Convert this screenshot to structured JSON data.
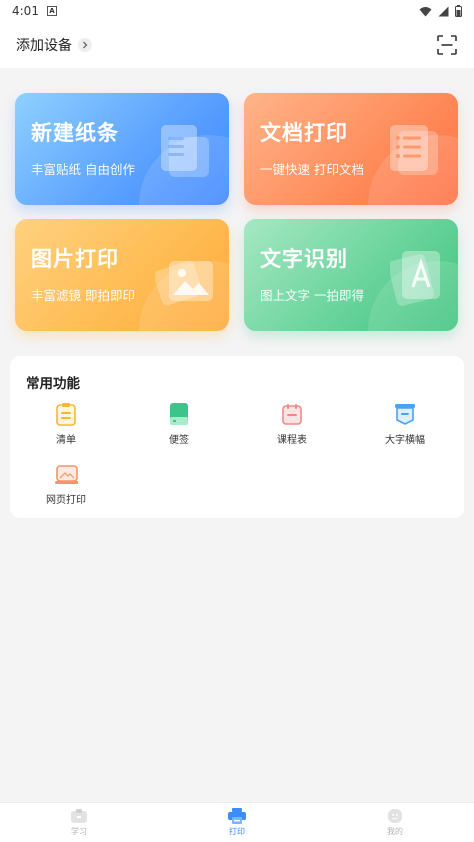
{
  "status_bar": {
    "time": "4:01",
    "notification_badge": "A",
    "icons": [
      "wifi-icon",
      "signal-icon",
      "battery-icon"
    ]
  },
  "header": {
    "add_device_label": "添加设备",
    "scan_icon": "scan-icon"
  },
  "cards": [
    {
      "title": "新建纸条",
      "subtitle": "丰富贴纸 自由创作",
      "icon": "document-icon",
      "color": "#4f96ff"
    },
    {
      "title": "文档打印",
      "subtitle": "一键快速 打印文档",
      "icon": "list-document-icon",
      "color": "#ff8552"
    },
    {
      "title": "图片打印",
      "subtitle": "丰富滤镜 即拍即印",
      "icon": "image-icon",
      "color": "#ffb547"
    },
    {
      "title": "文字识别",
      "subtitle": "图上文字 一拍即得",
      "icon": "text-recognition-icon",
      "color": "#55cc8e"
    }
  ],
  "functions": {
    "title": "常用功能",
    "items": [
      {
        "label": "清单",
        "icon": "checklist-icon",
        "color": "#f7b733"
      },
      {
        "label": "便签",
        "icon": "note-icon",
        "color": "#3cc48a"
      },
      {
        "label": "课程表",
        "icon": "calendar-icon",
        "color": "#f08a8a"
      },
      {
        "label": "大字横幅",
        "icon": "banner-icon",
        "color": "#4aa3f0"
      },
      {
        "label": "网页打印",
        "icon": "web-print-icon",
        "color": "#f5946a"
      }
    ]
  },
  "bottom_nav": {
    "items": [
      {
        "label": "学习",
        "icon": "study-icon",
        "active": false
      },
      {
        "label": "打印",
        "icon": "printer-icon",
        "active": true
      },
      {
        "label": "我的",
        "icon": "profile-icon",
        "active": false
      }
    ],
    "active_color": "#3a8cff"
  }
}
